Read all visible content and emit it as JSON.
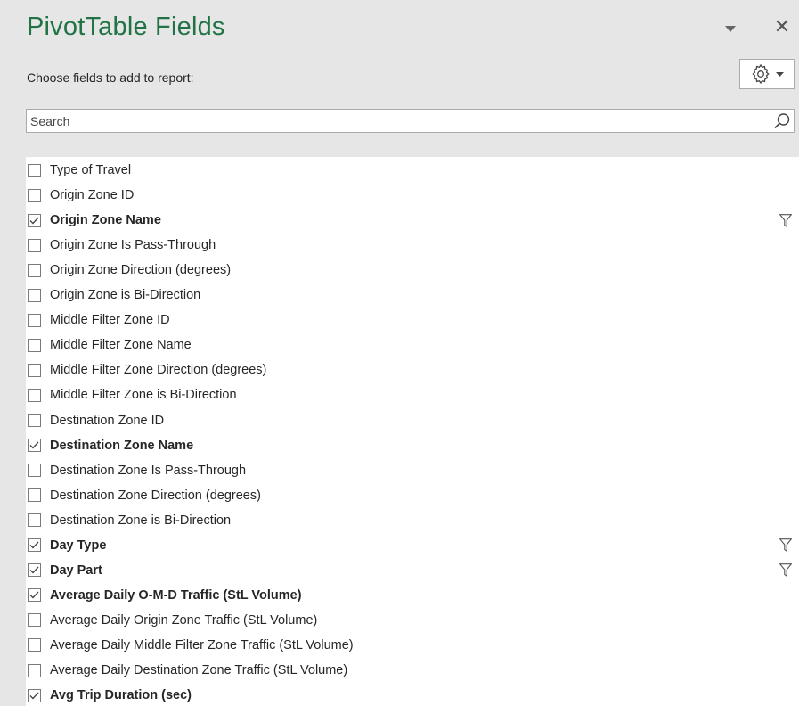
{
  "panel": {
    "title": "PivotTable Fields",
    "close_glyph": "✕",
    "subtitle": "Choose fields to add to report:",
    "search_placeholder": "Search"
  },
  "icons": {
    "task_pane_options": "chevron-down-icon",
    "close": "close-icon",
    "tools": "gear-icon",
    "search": "search-icon",
    "filter": "filter-icon"
  },
  "colors": {
    "title": "#217346",
    "panel_bg": "#e6e6e6",
    "list_bg": "#ffffff"
  },
  "fields": [
    {
      "label": "Type of Travel",
      "checked": false,
      "filtered": false
    },
    {
      "label": "Origin Zone ID",
      "checked": false,
      "filtered": false
    },
    {
      "label": "Origin Zone Name",
      "checked": true,
      "filtered": true
    },
    {
      "label": "Origin Zone Is Pass-Through",
      "checked": false,
      "filtered": false
    },
    {
      "label": "Origin Zone Direction (degrees)",
      "checked": false,
      "filtered": false
    },
    {
      "label": "Origin Zone is Bi-Direction",
      "checked": false,
      "filtered": false
    },
    {
      "label": "Middle Filter Zone ID",
      "checked": false,
      "filtered": false
    },
    {
      "label": "Middle Filter Zone Name",
      "checked": false,
      "filtered": false
    },
    {
      "label": "Middle Filter Zone Direction (degrees)",
      "checked": false,
      "filtered": false
    },
    {
      "label": "Middle Filter Zone is Bi-Direction",
      "checked": false,
      "filtered": false
    },
    {
      "label": "Destination Zone ID",
      "checked": false,
      "filtered": false
    },
    {
      "label": "Destination Zone Name",
      "checked": true,
      "filtered": false
    },
    {
      "label": "Destination Zone Is Pass-Through",
      "checked": false,
      "filtered": false
    },
    {
      "label": "Destination Zone Direction (degrees)",
      "checked": false,
      "filtered": false
    },
    {
      "label": "Destination Zone is Bi-Direction",
      "checked": false,
      "filtered": false
    },
    {
      "label": "Day Type",
      "checked": true,
      "filtered": true
    },
    {
      "label": "Day Part",
      "checked": true,
      "filtered": true
    },
    {
      "label": "Average Daily O-M-D Traffic (StL Volume)",
      "checked": true,
      "filtered": false
    },
    {
      "label": "Average Daily Origin Zone Traffic (StL Volume)",
      "checked": false,
      "filtered": false
    },
    {
      "label": "Average Daily Middle Filter Zone Traffic (StL Volume)",
      "checked": false,
      "filtered": false
    },
    {
      "label": "Average Daily Destination Zone Traffic (StL Volume)",
      "checked": false,
      "filtered": false
    },
    {
      "label": "Avg Trip Duration (sec)",
      "checked": true,
      "filtered": false
    }
  ]
}
